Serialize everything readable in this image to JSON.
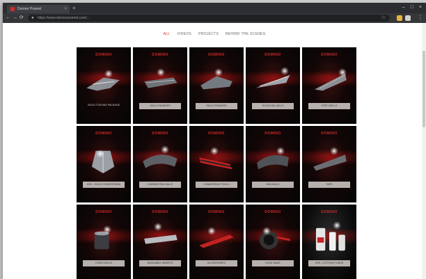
{
  "browser": {
    "tab_title": "Dormer Pramet",
    "tab_close": "×",
    "new_tab": "+",
    "nav": {
      "back": "←",
      "forward": "→",
      "reload": "⟳"
    },
    "url": "https://www.dormerpramet.com/...",
    "window_controls": [
      "–",
      "□",
      "×"
    ],
    "menu": "⋮"
  },
  "site": {
    "nav": [
      "ALL",
      "VIDEOS",
      "PROJECTS",
      "BEHIND THE SCENES"
    ],
    "active_nav": "ALL"
  },
  "tiles": [
    {
      "logo": "DOMINO",
      "label": "SOLID TOOLING PACKAGE"
    },
    {
      "logo": "DOMINO",
      "label": "SOLID REAMERS"
    },
    {
      "logo": "DOMINO",
      "label": "SOLID REAMERS"
    },
    {
      "logo": "DOMINO",
      "label": "SOLID END MILLS"
    },
    {
      "logo": "DOMINO",
      "label": "STEP DRILLS"
    },
    {
      "logo": "DOMINO",
      "label": "HSS - SOLID COUNTERSINK"
    },
    {
      "logo": "DOMINO",
      "label": "CARBIDE END MILLS"
    },
    {
      "logo": "DOMINO",
      "label": "CHAMFERING TOOLS"
    },
    {
      "logo": "DOMINO",
      "label": "END MILLS"
    },
    {
      "logo": "DOMINO",
      "label": "TAPS"
    },
    {
      "logo": "DOMINO",
      "label": "CORE DRILLS"
    },
    {
      "logo": "DOMINO",
      "label": "INDEXABLE INSERTS"
    },
    {
      "logo": "DOMINO",
      "label": "ACCESSORIES"
    },
    {
      "logo": "DOMINO",
      "label": "HOLE SAWS"
    },
    {
      "logo": "DOMINO",
      "label": "HSS - CUTTING FLUIDS"
    }
  ],
  "colors": {
    "accent": "#c9302c",
    "tile_bg": "#0b0505"
  }
}
